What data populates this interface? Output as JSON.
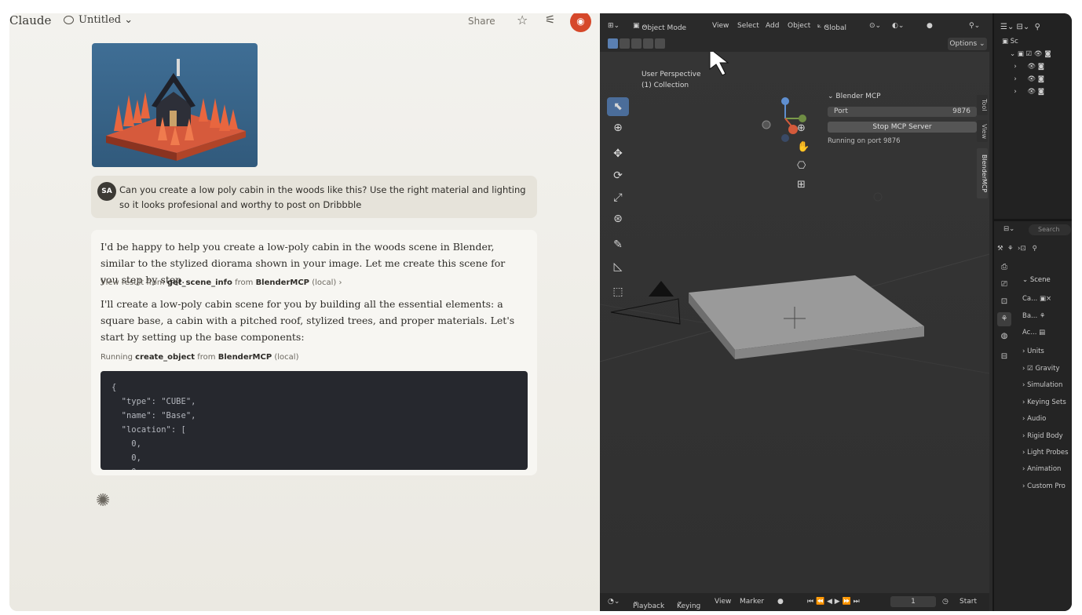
{
  "claude": {
    "logo": "Claude",
    "chat_title": "Untitled",
    "share_label": "Share",
    "user_initials": "SA",
    "user_message": "Can you create a low poly cabin in the woods like this? Use the right material and lighting so it looks profesional and worthy to post on Dribbble",
    "reply_p1": "I'd be happy to help you create a low-poly cabin in the woods scene in Blender, similar to the stylized diorama shown in your image. Let me create this scene for you step by step.",
    "tool1": {
      "prefix": "View result from",
      "name": "get_scene_info",
      "mid": "from",
      "server": "BlenderMCP",
      "suffix": "(local)"
    },
    "reply_p2": "I'll create a low-poly cabin scene for you by building all the essential elements: a square base, a cabin with a pitched roof, stylized trees, and proper materials. Let's start by setting up the base components:",
    "tool2": {
      "prefix": "Running",
      "name": "create_object",
      "mid": "from",
      "server": "BlenderMCP",
      "suffix": "(local)"
    },
    "code": "{\n  \"type\": \"CUBE\",\n  \"name\": \"Base\",\n  \"location\": [\n    0,\n    0,\n    0"
  },
  "blender": {
    "header": {
      "mode": "Object Mode",
      "menu": [
        "View",
        "Select",
        "Add",
        "Object"
      ],
      "transform": "Global",
      "options": "Options"
    },
    "viewport": {
      "perspective": "User Perspective",
      "collection": "(1) Collection"
    },
    "mcp_panel": {
      "title": "Blender MCP",
      "port_label": "Port",
      "port_value": "9876",
      "stop_label": "Stop MCP Server",
      "status": "Running on port 9876"
    },
    "side_tabs": [
      "Tool",
      "View",
      "BlenderMCP"
    ],
    "timeline": {
      "items": [
        "Playback",
        "Keying",
        "View",
        "Marker"
      ],
      "frame": "1",
      "start_label": "Start"
    },
    "outliner": {
      "root": "Sc"
    },
    "properties": {
      "search": "Search",
      "scene_header": "Scene",
      "fields": [
        "Ca...",
        "Ba...",
        "Ac..."
      ],
      "sections": [
        "Units",
        "Gravity",
        "Simulation",
        "Keying Sets",
        "Audio",
        "Rigid Body",
        "Light Probes",
        "Animation",
        "Custom Pro"
      ]
    }
  },
  "colors": {
    "accent_orange": "#d6482a",
    "blender_active": "#4b6d9a"
  }
}
